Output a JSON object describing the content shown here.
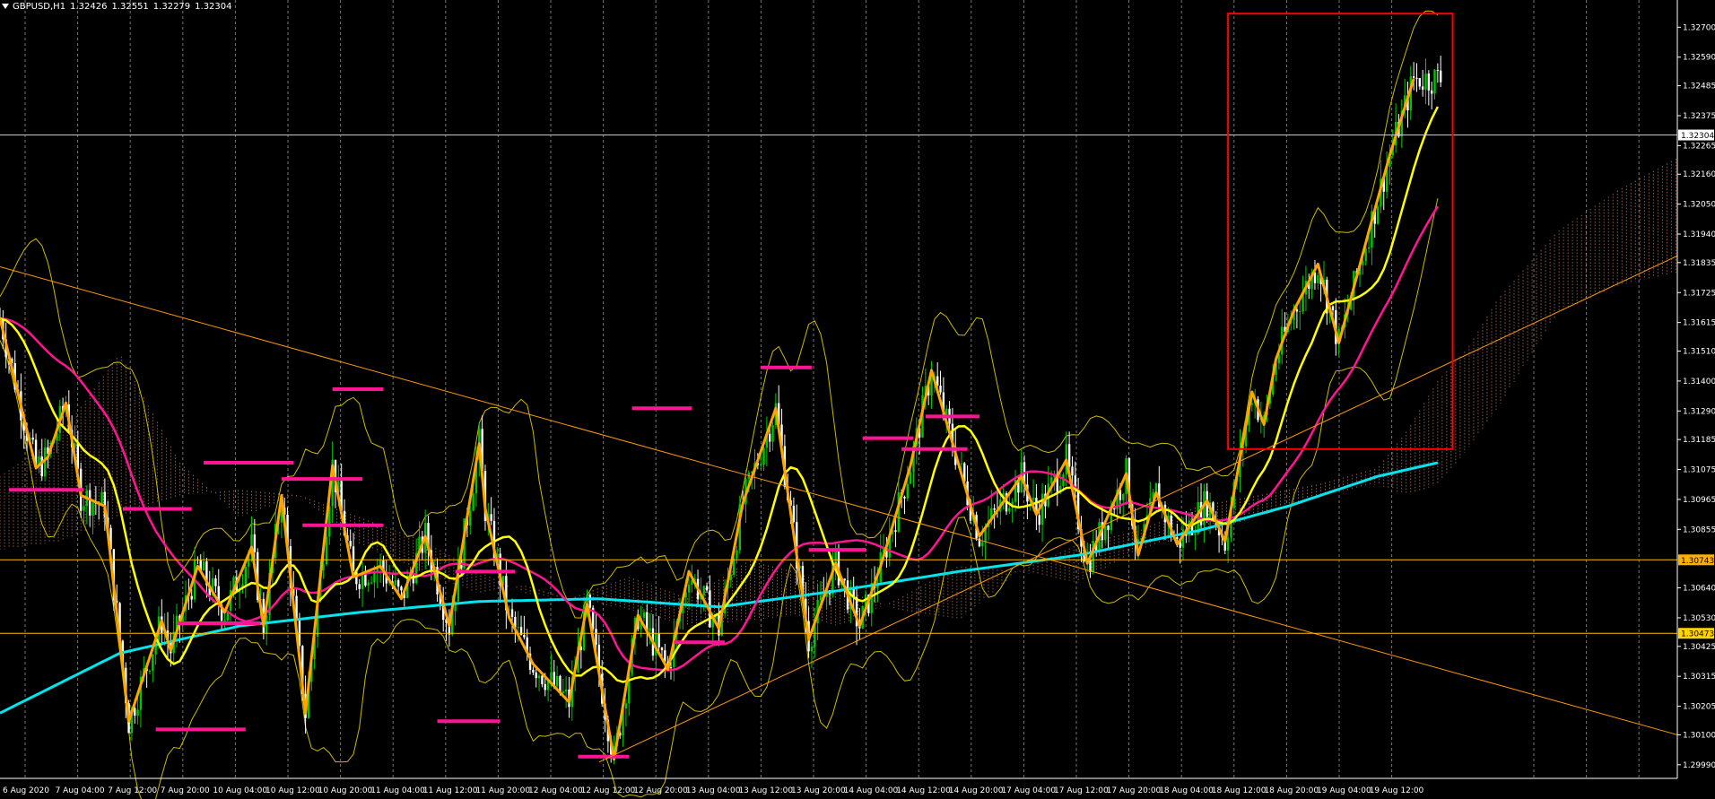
{
  "window": {
    "symbol": "GBPUSD,H1",
    "ohlc": [
      "1.32426",
      "1.32551",
      "1.32279",
      "1.32304"
    ]
  },
  "colors": {
    "background": "#000000",
    "grid": "#c8c8c8",
    "candle_up": "#00c800",
    "candle_down": "#ffffff",
    "zigzag": "#ffa500",
    "sma_fast": "#ffff00",
    "sma_mid": "#ff1493",
    "sma_slow": "#00e5ee",
    "bands": "#ccbb00",
    "kumo": "#d2876f",
    "support_resistance": "#ff1493",
    "box": "#ff0000",
    "trendline": "#ff9900",
    "hline": "#ffc000",
    "price_line": "#c8c8c8"
  },
  "chart_data": {
    "type": "candlestick",
    "symbol": "GBPUSD",
    "timeframe": "H1",
    "ylim": [
      1.2994,
      1.328
    ],
    "last_price": 1.32304,
    "x_tick_labels": [
      "6 Aug 2020",
      "7 Aug 04:00",
      "7 Aug 12:00",
      "7 Aug 20:00",
      "10 Aug 04:00",
      "10 Aug 12:00",
      "10 Aug 20:00",
      "11 Aug 04:00",
      "11 Aug 12:00",
      "11 Aug 20:00",
      "12 Aug 04:00",
      "12 Aug 12:00",
      "12 Aug 20:00",
      "13 Aug 04:00",
      "13 Aug 12:00",
      "13 Aug 20:00",
      "14 Aug 04:00",
      "14 Aug 12:00",
      "14 Aug 20:00",
      "17 Aug 04:00",
      "17 Aug 12:00",
      "17 Aug 20:00",
      "18 Aug 04:00",
      "18 Aug 12:00",
      "18 Aug 20:00",
      "19 Aug 04:00",
      "19 Aug 12:00"
    ],
    "y_tick_labels": [
      "1.32700",
      "1.32590",
      "1.32485",
      "1.32375",
      "1.32265",
      "1.32160",
      "1.32050",
      "1.31940",
      "1.31835",
      "1.31725",
      "1.31615",
      "1.31510",
      "1.31400",
      "1.31290",
      "1.31185",
      "1.31075",
      "1.30965",
      "1.30855",
      "1.30640",
      "1.30530",
      "1.30425",
      "1.30315",
      "1.30205",
      "1.30100",
      "1.29990"
    ],
    "price_tags": [
      {
        "label": "1.32304",
        "value": 1.32304,
        "color": "#ffffff",
        "text_color": "#000000"
      },
      {
        "label": "1.30743",
        "value": 1.30743,
        "color": "#ffb000",
        "text_color": "#000000"
      },
      {
        "label": "1.30473",
        "value": 1.30473,
        "color": "#ffd400",
        "text_color": "#000000"
      }
    ],
    "horizontal_lines": [
      1.30743,
      1.30473
    ],
    "zigzag": [
      [
        0,
        1.3163
      ],
      [
        12,
        1.3108
      ],
      [
        16,
        1.3112
      ],
      [
        22,
        1.3132
      ],
      [
        27,
        1.3098
      ],
      [
        35,
        1.3094
      ],
      [
        43,
        1.3015
      ],
      [
        54,
        1.3052
      ],
      [
        57,
        1.3041
      ],
      [
        66,
        1.3072
      ],
      [
        75,
        1.3055
      ],
      [
        84,
        1.3079
      ],
      [
        88,
        1.305
      ],
      [
        94,
        1.3098
      ],
      [
        102,
        1.3018
      ],
      [
        111,
        1.3109
      ],
      [
        118,
        1.3068
      ],
      [
        127,
        1.3072
      ],
      [
        134,
        1.306
      ],
      [
        142,
        1.3083
      ],
      [
        150,
        1.305
      ],
      [
        160,
        1.3117
      ],
      [
        162,
        1.3093
      ],
      [
        170,
        1.3053
      ],
      [
        178,
        1.3036
      ],
      [
        190,
        1.3022
      ],
      [
        196,
        1.3058
      ],
      [
        205,
        1.3001
      ],
      [
        213,
        1.3054
      ],
      [
        223,
        1.3034
      ],
      [
        230,
        1.307
      ],
      [
        240,
        1.3049
      ],
      [
        248,
        1.3095
      ],
      [
        259,
        1.313
      ],
      [
        270,
        1.3045
      ],
      [
        279,
        1.3073
      ],
      [
        287,
        1.305
      ],
      [
        294,
        1.3072
      ],
      [
        304,
        1.3109
      ],
      [
        311,
        1.3144
      ],
      [
        327,
        1.3083
      ],
      [
        341,
        1.3105
      ],
      [
        346,
        1.3091
      ],
      [
        356,
        1.3111
      ],
      [
        363,
        1.3073
      ],
      [
        376,
        1.3106
      ],
      [
        380,
        1.3076
      ],
      [
        386,
        1.3099
      ],
      [
        393,
        1.308
      ],
      [
        403,
        1.3096
      ],
      [
        409,
        1.3081
      ],
      [
        418,
        1.3136
      ],
      [
        422,
        1.3124
      ],
      [
        426,
        1.3148
      ],
      [
        432,
        1.3166
      ],
      [
        440,
        1.3183
      ],
      [
        447,
        1.3154
      ],
      [
        457,
        1.3195
      ],
      [
        464,
        1.3223
      ],
      [
        472,
        1.3251
      ]
    ],
    "sr_segments": [
      [
        3,
        28,
        1.31
      ],
      [
        52,
        82,
        1.3012
      ],
      [
        41,
        64,
        1.3093
      ],
      [
        68,
        98,
        1.311
      ],
      [
        94,
        121,
        1.3104
      ],
      [
        101,
        128,
        1.3087
      ],
      [
        59,
        87,
        1.3051
      ],
      [
        111,
        128,
        1.3137
      ],
      [
        152,
        172,
        1.307
      ],
      [
        146,
        167,
        1.3015
      ],
      [
        193,
        210,
        1.3002
      ],
      [
        211,
        231,
        1.313
      ],
      [
        225,
        242,
        1.3044
      ],
      [
        254,
        271,
        1.3145
      ],
      [
        270,
        289,
        1.3078
      ],
      [
        288,
        305,
        1.3119
      ],
      [
        301,
        323,
        1.3115
      ],
      [
        309,
        327,
        1.3127
      ]
    ],
    "box": {
      "x0": 410,
      "x1": 485,
      "y_top": 1.3275,
      "y_bottom": 1.3115
    },
    "trendlines": [
      {
        "from": [
          0,
          1.3182
        ],
        "to": [
          560,
          1.301
        ]
      },
      {
        "from": [
          200,
          1.3
        ],
        "to": [
          560,
          1.3186
        ]
      }
    ]
  }
}
